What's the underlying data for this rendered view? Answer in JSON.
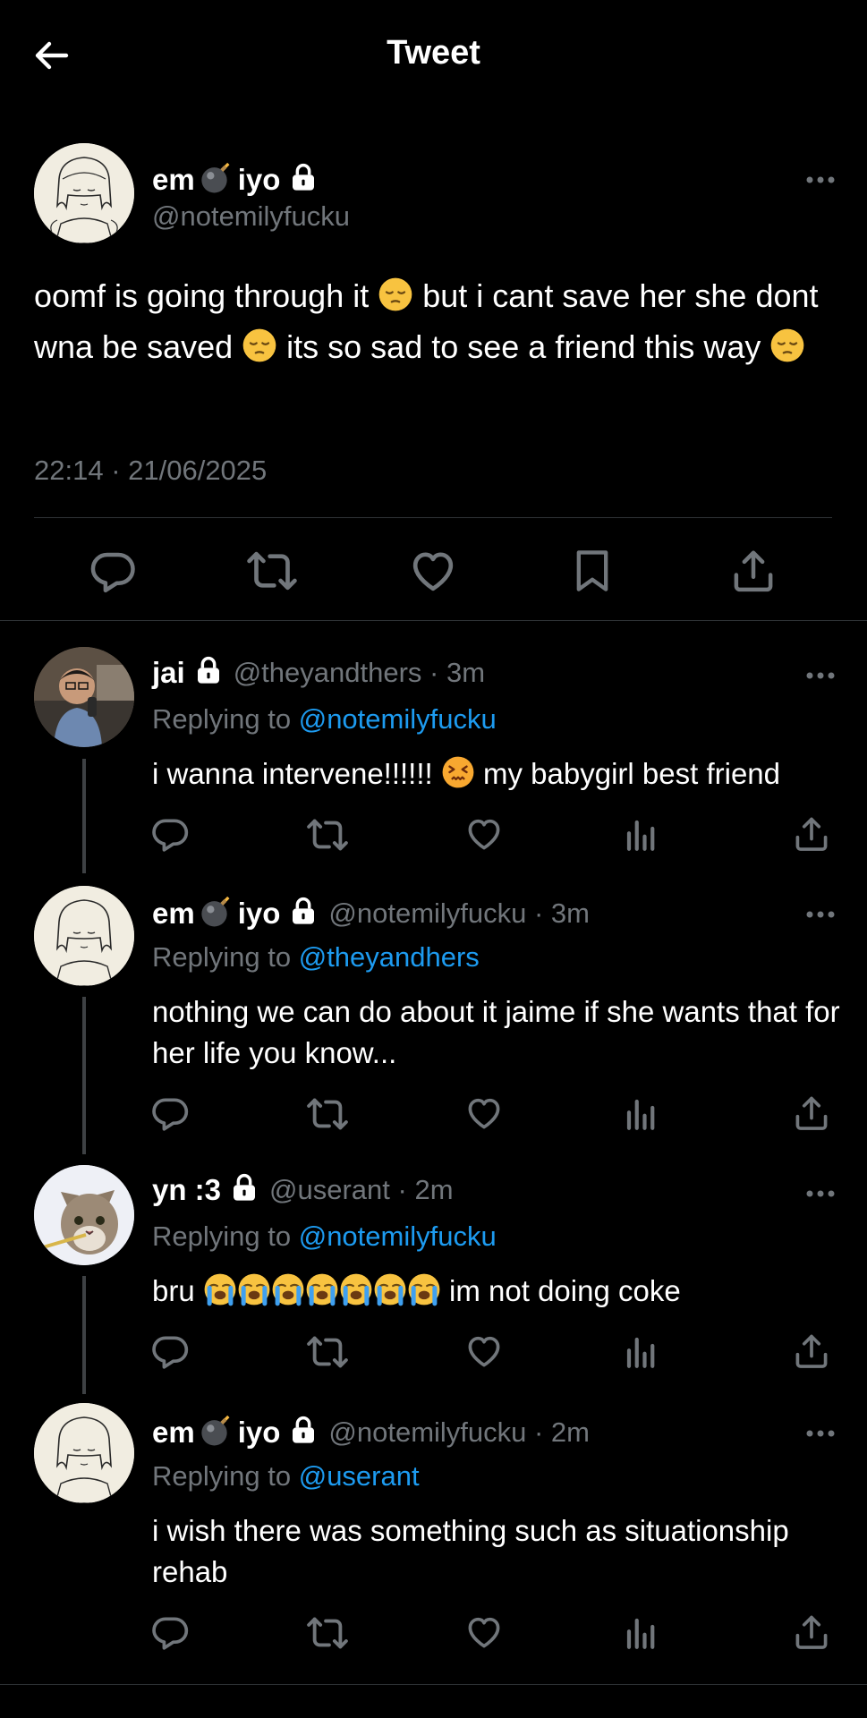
{
  "header": {
    "title": "Tweet"
  },
  "main_tweet": {
    "display_name_left": "em",
    "display_name_right": "iyo",
    "handle": "@notemilyfucku",
    "text_parts": [
      "oomf is going through it ",
      " but i cant save her she dont wna be saved ",
      " its so sad to see a friend this way "
    ],
    "timestamp": "22:14 · 21/06/2025"
  },
  "replies": [
    {
      "display_name": "jai",
      "handle_time": "@theyandthers · 3m",
      "replying_prefix": "Replying to ",
      "replying_to": "@notemilyfucku",
      "text_a": "i wanna intervene!!!!!! ",
      "text_b": " my babygirl best friend"
    },
    {
      "display_name_left": "em",
      "display_name_right": "iyo",
      "handle_time": "@notemilyfucku · 3m",
      "replying_prefix": "Replying to ",
      "replying_to": "@theyandhers",
      "text": "nothing we can do about it jaime if she wants that for her life you know..."
    },
    {
      "display_name": "yn :3",
      "handle_time": "@userant · 2m",
      "replying_prefix": "Replying to ",
      "replying_to": "@notemilyfucku",
      "text_a": "bru ",
      "text_b": " im not doing coke"
    },
    {
      "display_name_left": "em",
      "display_name_right": "iyo",
      "handle_time": "@notemilyfucku · 2m",
      "replying_prefix": "Replying to ",
      "replying_to": "@userant",
      "text": "i wish there was something such as situationship rehab"
    }
  ],
  "icons": {
    "back": "arrow-left-icon",
    "more": "more-horizontal-icon",
    "reply": "reply-bubble-icon",
    "retweet": "retweet-icon",
    "like": "heart-icon",
    "bookmark": "bookmark-icon",
    "share": "share-icon",
    "views": "views-chart-icon",
    "lock": "lock-icon",
    "bomb": "bomb-emoji-icon",
    "pensive": "pensive-face-emoji",
    "confounded": "confounded-face-emoji",
    "crying": "loudly-crying-face-emoji"
  },
  "colors": {
    "background": "#000000",
    "text_primary": "#e7e9ea",
    "text_secondary": "#71767b",
    "link": "#1d9bf0",
    "divider": "#2f3336"
  }
}
